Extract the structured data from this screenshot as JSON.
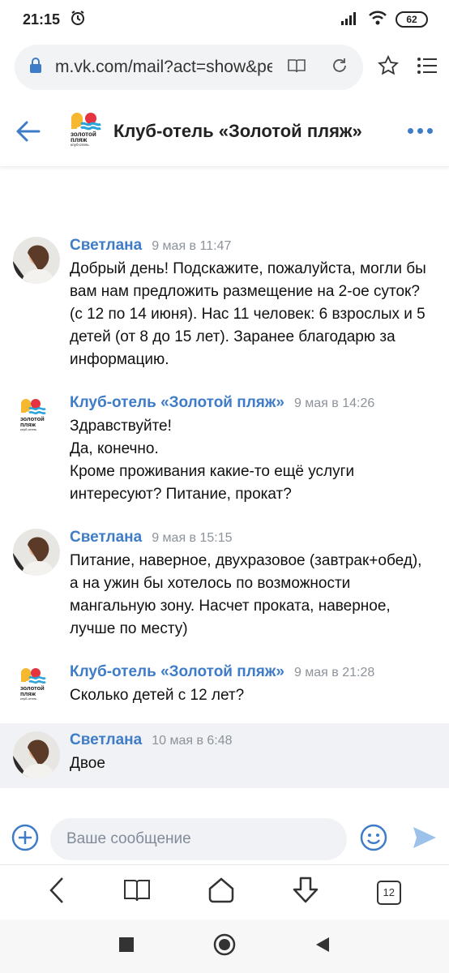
{
  "status_bar": {
    "time": "21:15",
    "alarm_icon": "alarm-clock-icon",
    "signal_icon": "signal-icon",
    "wifi_icon": "wifi-icon",
    "battery": "62"
  },
  "browser": {
    "url": "m.vk.com/mail?act=show&pee",
    "lock_icon": "lock-icon",
    "reader_icon": "book-icon",
    "reload_icon": "reload-icon",
    "star_icon": "star-icon",
    "menu_icon": "list-menu-icon"
  },
  "header": {
    "title": "Клуб-отель «Золотой пляж»",
    "logo_text_line1": "золотой",
    "logo_text_line2": "пляж",
    "logo_text_line3": "клуб-отель"
  },
  "messages": [
    {
      "author": "Светлана",
      "time": "9 мая в 11:47",
      "avatar": "user-photo",
      "lines": [
        "Добрый день! Подскажите, пожалуйста, могли бы вам нам предложить размещение на 2-ое суток? (с 12 по 14 июня). Нас 11 человек: 6 взрослых и 5 детей (от 8 до 15 лет). Заранее благодарю за информацию."
      ]
    },
    {
      "author": "Клуб-отель «Золотой пляж»",
      "time": "9 мая в 14:26",
      "avatar": "hotel-logo",
      "lines": [
        "Здравствуйте!",
        "Да, конечно.",
        "Кроме проживания какие-то ещё услуги интересуют? Питание, прокат?"
      ]
    },
    {
      "author": "Светлана",
      "time": "9 мая в 15:15",
      "avatar": "user-photo",
      "lines": [
        "Питание, наверное, двухразовое (завтрак+обед), а на ужин бы хотелось по возможности мангальную зону. Насчет проката, наверное, лучше по месту)"
      ]
    },
    {
      "author": "Клуб-отель «Золотой пляж»",
      "time": "9 мая в 21:28",
      "avatar": "hotel-logo",
      "lines": [
        "Сколько детей с 12 лет?"
      ]
    },
    {
      "author": "Светлана",
      "time": "10 мая в 6:48",
      "avatar": "user-photo",
      "lines": [
        "Двое"
      ]
    }
  ],
  "composer": {
    "placeholder": "Ваше сообщение"
  },
  "browser_nav": {
    "tabs_count": "12"
  },
  "colors": {
    "accent": "#3f7cc7",
    "time": "#8c939b",
    "highlight": "#f0f2f5"
  }
}
